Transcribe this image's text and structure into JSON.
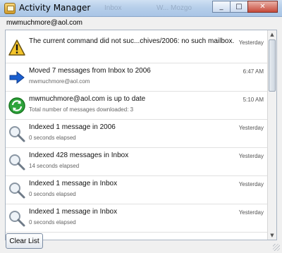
{
  "window": {
    "title": "Activity Manager",
    "faded_labels": [
      "Inbox",
      "W... Mozgo"
    ],
    "controls": {
      "minimize_icon": "minimize-icon",
      "maximize_icon": "maximize-icon",
      "close_icon": "close-icon"
    }
  },
  "header": {
    "account": "mwmuchmore@aol.com"
  },
  "activities": [
    {
      "icon": "warning-icon",
      "title": "The current command did not suc...chives/2006: no such mailbox.",
      "subtitle": "",
      "time": "Yesterday"
    },
    {
      "icon": "move-arrow-icon",
      "title": "Moved 7 messages from Inbox to 2006",
      "subtitle": "mwmuchmore@aol.com",
      "time": "6:47 AM"
    },
    {
      "icon": "sync-icon",
      "title": "mwmuchmore@aol.com is up to date",
      "subtitle": "Total number of messages downloaded: 3",
      "time": "5:10 AM"
    },
    {
      "icon": "search-icon",
      "title": "Indexed 1 message in 2006",
      "subtitle": "0 seconds elapsed",
      "time": "Yesterday"
    },
    {
      "icon": "search-icon",
      "title": "Indexed 428 messages in Inbox",
      "subtitle": "14 seconds elapsed",
      "time": "Yesterday"
    },
    {
      "icon": "search-icon",
      "title": "Indexed 1 message in Inbox",
      "subtitle": "0 seconds elapsed",
      "time": "Yesterday"
    },
    {
      "icon": "search-icon",
      "title": "Indexed 1 message in Inbox",
      "subtitle": "0 seconds elapsed",
      "time": "Yesterday"
    }
  ],
  "footer": {
    "clear_button": "Clear List"
  },
  "colors": {
    "titlebar": "#b7cfea",
    "warning": "#f4c52b",
    "move_arrow": "#1a5fd0",
    "sync": "#2ea43b",
    "search": "#8a96a3"
  }
}
